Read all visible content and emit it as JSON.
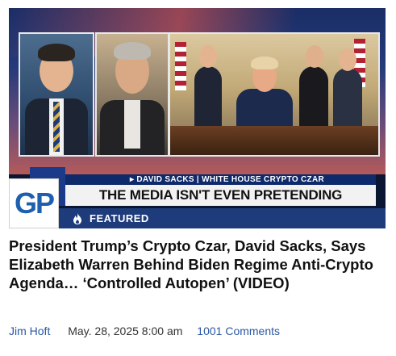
{
  "hero": {
    "chyron_top": "▸ DAVID SACKS | WHITE HOUSE CRYPTO CZAR",
    "chyron_main": "THE MEDIA ISN'T EVEN PRETENDING ANYMORE",
    "logo_text": "GP",
    "featured_label": "FEATURED",
    "featured_icon": "fire-icon"
  },
  "article": {
    "title": "President Trump’s Crypto Czar, David Sacks, Says Elizabeth Warren Behind Biden Regime Anti-Crypto Agenda… ‘Controlled Autopen’ (VIDEO)",
    "author": "Jim Hoft",
    "date": "May. 28, 2025 8:00 am",
    "comments": "1001 Comments"
  },
  "colors": {
    "featured_bar": "#1e3b7b",
    "link": "#2b57a3",
    "logo": "#1f5fb0"
  }
}
